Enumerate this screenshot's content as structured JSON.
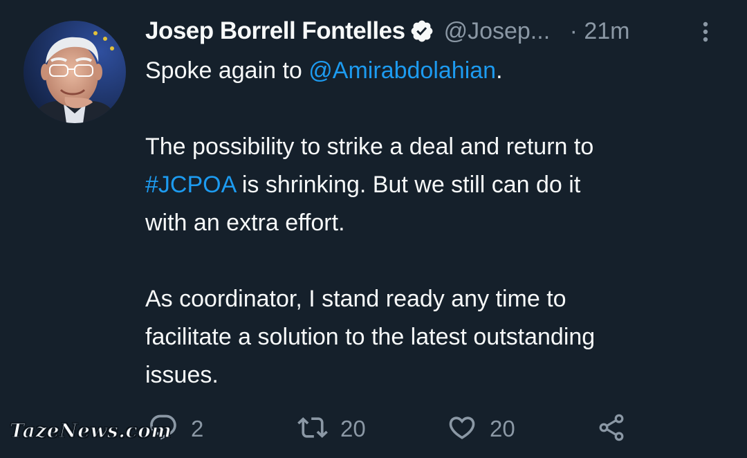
{
  "tweet": {
    "author_name": "Josep Borrell Fontelles",
    "handle": "@Josep...",
    "time": "· 21m",
    "verified": true,
    "lines": {
      "p1_prefix": "Spoke again to ",
      "p1_mention": "@Amirabdolahian",
      "p1_suffix": ".",
      "p2_line1": "The possibility to strike a deal and return to",
      "p2_hashtag": "#JCPOA",
      "p2_line2_rest": " is shrinking. But we still can do it",
      "p2_line3": "with an extra effort.",
      "p3_line1": "As coordinator, I stand ready any time to",
      "p3_line2": "facilitate a solution to the latest outstanding",
      "p3_line3": "issues."
    },
    "actions": {
      "reply_count": "2",
      "retweet_count": "20",
      "like_count": "20"
    }
  },
  "watermark": "TazeNews.com",
  "colors": {
    "background": "#15202b",
    "text": "#f7f9f9",
    "secondary": "#8b98a5",
    "link": "#1d9bf0"
  },
  "icons": [
    "avatar-photo",
    "verified-badge-icon",
    "more-options-icon",
    "reply-icon",
    "retweet-icon",
    "like-icon",
    "share-icon"
  ]
}
